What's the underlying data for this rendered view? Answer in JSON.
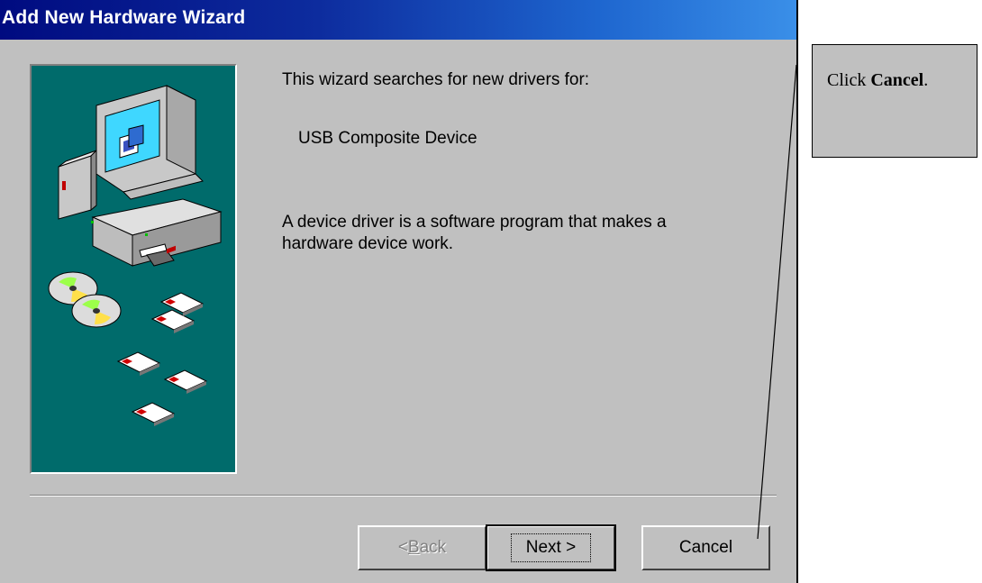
{
  "window": {
    "title": "Add New Hardware Wizard"
  },
  "content": {
    "intro": "This wizard searches for new drivers for:",
    "device_name": "USB Composite Device",
    "description_line1": "A device driver is a software program that makes a",
    "description_line2": "hardware device work."
  },
  "buttons": {
    "back": {
      "prefix": "< ",
      "mnemonic": "B",
      "rest": "ack"
    },
    "next": "Next >",
    "cancel": "Cancel"
  },
  "callout": {
    "text_before": "Click ",
    "text_bold": "Cancel",
    "text_after": "."
  },
  "icons": [
    "computer-icon",
    "cd-disc-icon",
    "floppy-disk-icon"
  ],
  "colors": {
    "dialog_bg": "#c0c0c0",
    "title_start": "#000b80",
    "title_end": "#3a8fe8",
    "side_panel": "#006b6b"
  }
}
